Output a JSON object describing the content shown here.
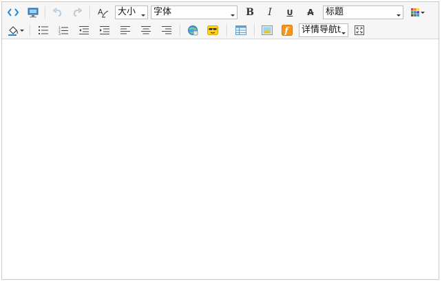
{
  "toolbar": {
    "row1": {
      "size_combo_value": "大小",
      "font_combo_value": "字体",
      "heading_combo_value": "标题"
    },
    "row2": {
      "nav_combo_value": "详情导航t"
    }
  },
  "icons": {
    "source": "source-code-icon",
    "preview": "preview-monitor-icon",
    "undo": "undo-icon",
    "redo": "redo-icon",
    "clear_format": "clear-format-icon",
    "bold": "bold-icon",
    "italic": "italic-icon",
    "underline": "underline-icon",
    "strikethrough": "strikethrough-icon",
    "color_grid": "color-grid-icon",
    "fill_color": "fill-color-icon",
    "unordered_list": "unordered-list-icon",
    "ordered_list": "ordered-list-icon",
    "outdent": "outdent-icon",
    "indent": "indent-icon",
    "align_left": "align-left-icon",
    "align_center": "align-center-icon",
    "align_right": "align-right-icon",
    "link": "link-globe-icon",
    "emoticon": "emoticon-icon",
    "table": "table-icon",
    "image": "image-icon",
    "flash": "flash-icon",
    "fullscreen": "fullscreen-icon"
  },
  "colors": {
    "toolbar_bg": "#f6f6f6",
    "border": "#c9c9c9",
    "accent_blue": "#1e88d8"
  }
}
